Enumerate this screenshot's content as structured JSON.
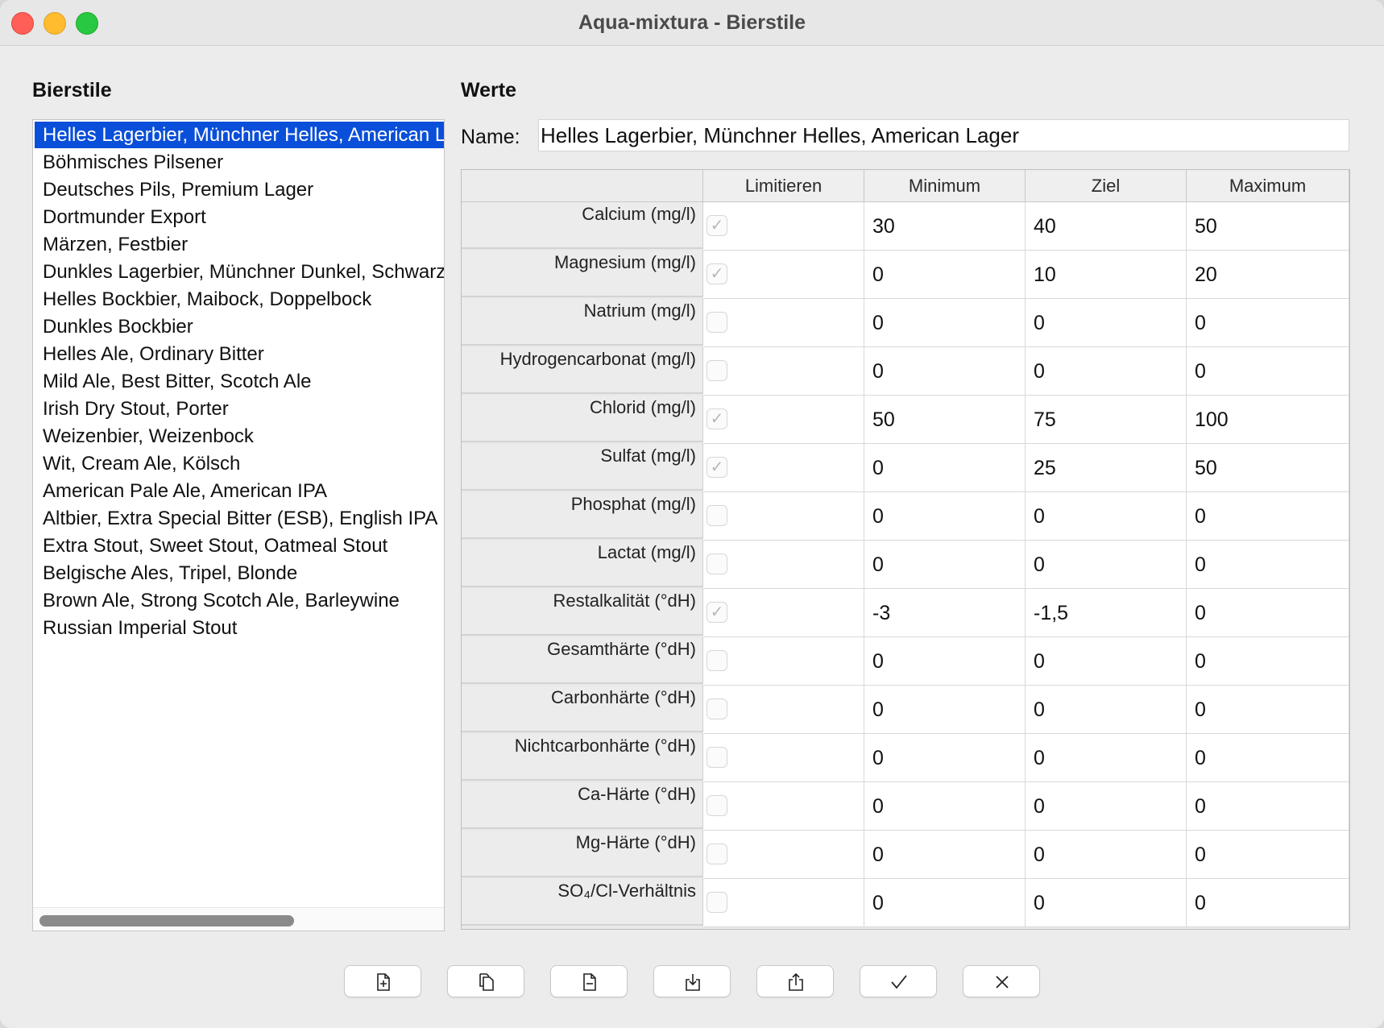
{
  "window": {
    "title": "Aqua-mixtura - Bierstile"
  },
  "left": {
    "heading": "Bierstile",
    "selected_index": 0,
    "styles": [
      "Helles Lagerbier, Münchner Helles, American Lager",
      "Böhmisches Pilsener",
      "Deutsches Pils, Premium Lager",
      "Dortmunder Export",
      "Märzen, Festbier",
      "Dunkles Lagerbier, Münchner Dunkel, Schwarzbier",
      "Helles Bockbier, Maibock, Doppelbock",
      "Dunkles Bockbier",
      "Helles Ale, Ordinary Bitter",
      "Mild Ale, Best Bitter, Scotch Ale",
      "Irish Dry Stout, Porter",
      "Weizenbier, Weizenbock",
      "Wit, Cream Ale, Kölsch",
      "American Pale Ale, American IPA",
      "Altbier, Extra Special Bitter (ESB), English IPA",
      "Extra Stout, Sweet Stout, Oatmeal Stout",
      "Belgische Ales, Tripel, Blonde",
      "Brown Ale, Strong Scotch Ale, Barleywine",
      "Russian Imperial Stout"
    ]
  },
  "right": {
    "heading": "Werte",
    "name_label": "Name:",
    "name_value": "Helles Lagerbier, Münchner Helles, American Lager",
    "columns": [
      "Limitieren",
      "Minimum",
      "Ziel",
      "Maximum"
    ],
    "rows": [
      {
        "label": "Calcium (mg/l)",
        "limit": true,
        "min": "30",
        "target": "40",
        "max": "50"
      },
      {
        "label": "Magnesium (mg/l)",
        "limit": true,
        "min": "0",
        "target": "10",
        "max": "20"
      },
      {
        "label": "Natrium (mg/l)",
        "limit": false,
        "min": "0",
        "target": "0",
        "max": "0"
      },
      {
        "label": "Hydrogencarbonat (mg/l)",
        "limit": false,
        "min": "0",
        "target": "0",
        "max": "0"
      },
      {
        "label": "Chlorid (mg/l)",
        "limit": true,
        "min": "50",
        "target": "75",
        "max": "100"
      },
      {
        "label": "Sulfat (mg/l)",
        "limit": true,
        "min": "0",
        "target": "25",
        "max": "50"
      },
      {
        "label": "Phosphat (mg/l)",
        "limit": false,
        "min": "0",
        "target": "0",
        "max": "0"
      },
      {
        "label": "Lactat (mg/l)",
        "limit": false,
        "min": "0",
        "target": "0",
        "max": "0"
      },
      {
        "label": "Restalkalität (°dH)",
        "limit": true,
        "min": "-3",
        "target": "-1,5",
        "max": "0"
      },
      {
        "label": "Gesamthärte (°dH)",
        "limit": false,
        "min": "0",
        "target": "0",
        "max": "0"
      },
      {
        "label": "Carbonhärte (°dH)",
        "limit": false,
        "min": "0",
        "target": "0",
        "max": "0"
      },
      {
        "label": "Nichtcarbonhärte (°dH)",
        "limit": false,
        "min": "0",
        "target": "0",
        "max": "0"
      },
      {
        "label": "Ca-Härte (°dH)",
        "limit": false,
        "min": "0",
        "target": "0",
        "max": "0"
      },
      {
        "label": "Mg-Härte (°dH)",
        "limit": false,
        "min": "0",
        "target": "0",
        "max": "0"
      },
      {
        "label": "SO₄/Cl-Verhältnis",
        "limit": false,
        "min": "0",
        "target": "0",
        "max": "0"
      }
    ]
  },
  "toolbar": {
    "buttons": [
      {
        "name": "new-style-button",
        "icon": "document-plus-icon"
      },
      {
        "name": "duplicate-style-button",
        "icon": "copy-icon"
      },
      {
        "name": "delete-style-button",
        "icon": "document-minus-icon"
      },
      {
        "name": "import-button",
        "icon": "import-icon"
      },
      {
        "name": "export-button",
        "icon": "share-icon"
      },
      {
        "name": "accept-button",
        "icon": "checkmark-icon"
      },
      {
        "name": "cancel-button",
        "icon": "close-icon"
      }
    ]
  },
  "colors": {
    "selection": "#0a4fd9",
    "close": "#ff5f57",
    "minimize": "#febc2e",
    "zoom": "#28c840"
  }
}
